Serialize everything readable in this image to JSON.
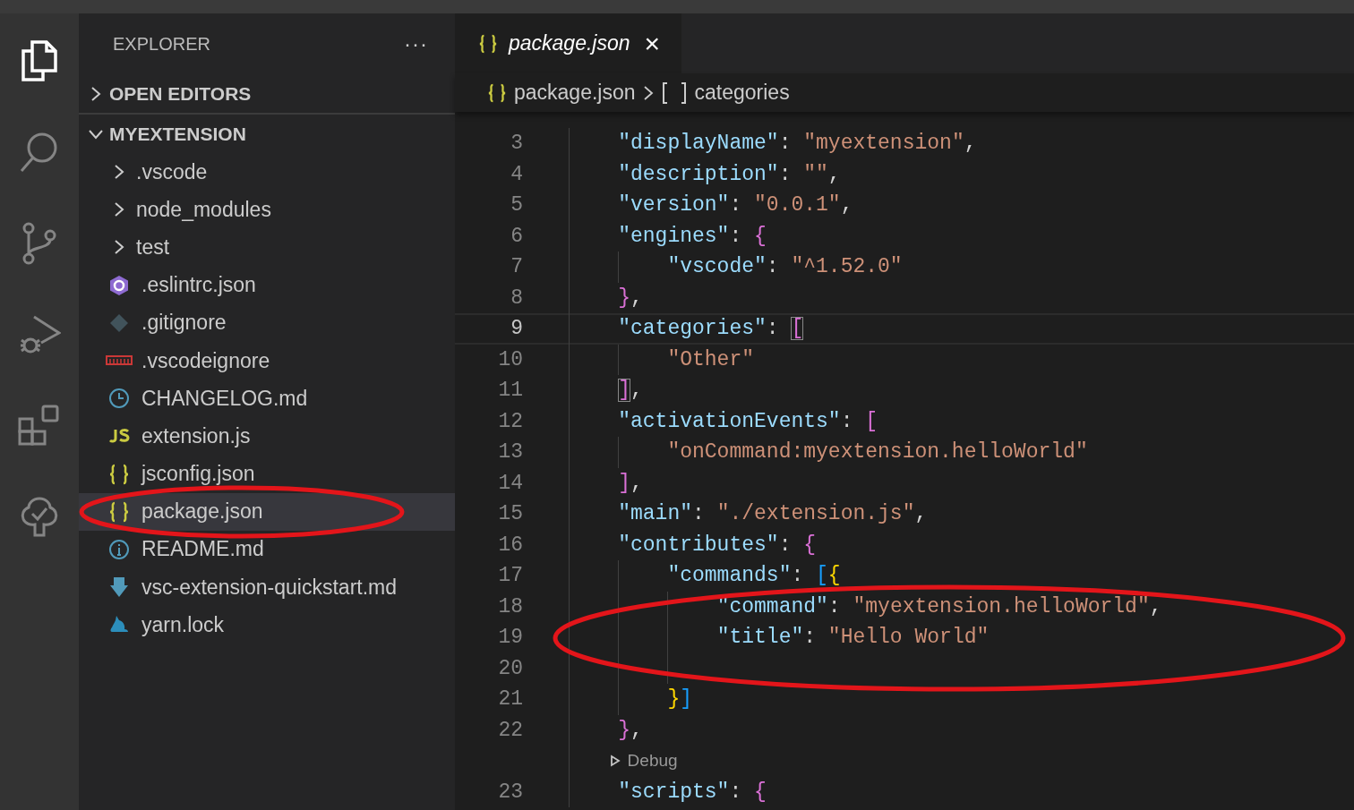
{
  "activity_bar": [
    {
      "kind": "files",
      "selected": true
    },
    {
      "kind": "search",
      "selected": false
    },
    {
      "kind": "source-control",
      "selected": false
    },
    {
      "kind": "run-debug",
      "selected": false
    },
    {
      "kind": "extensions",
      "selected": false
    },
    {
      "kind": "testing",
      "selected": false
    }
  ],
  "sidebar": {
    "title": "EXPLORER",
    "more": "···",
    "sections": [
      {
        "label": "OPEN EDITORS",
        "expanded": false
      },
      {
        "label": "MYEXTENSION",
        "expanded": true
      }
    ],
    "items": [
      {
        "kind": "folder",
        "label": ".vscode",
        "expanded": false,
        "selected": false
      },
      {
        "kind": "folder",
        "label": "node_modules",
        "expanded": false,
        "selected": false
      },
      {
        "kind": "folder",
        "label": "test",
        "expanded": false,
        "selected": false
      },
      {
        "kind": "eslint",
        "label": ".eslintrc.json",
        "selected": false
      },
      {
        "kind": "git",
        "label": ".gitignore",
        "selected": false
      },
      {
        "kind": "npm",
        "label": ".vscodeignore",
        "selected": false
      },
      {
        "kind": "changelog",
        "label": "CHANGELOG.md",
        "selected": false
      },
      {
        "kind": "js",
        "label": "extension.js",
        "selected": false
      },
      {
        "kind": "json",
        "label": "jsconfig.json",
        "selected": false
      },
      {
        "kind": "json",
        "label": "package.json",
        "selected": true
      },
      {
        "kind": "info",
        "label": "README.md",
        "selected": false
      },
      {
        "kind": "download",
        "label": "vsc-extension-quickstart.md",
        "selected": false
      },
      {
        "kind": "yarn",
        "label": "yarn.lock",
        "selected": false
      }
    ]
  },
  "tabs": [
    {
      "label": "package.json",
      "close": "×",
      "selected": true
    }
  ],
  "breadcrumb": [
    {
      "kind": "json",
      "label": "package.json"
    },
    {
      "kind": "array",
      "label": "categories"
    }
  ],
  "code": [
    {
      "number": "3",
      "current": false,
      "tokens": [
        {
          "kind": "key",
          "text": "\"displayName\""
        },
        {
          "kind": "punct",
          "text": ": "
        },
        {
          "kind": "string",
          "text": "\"myextension\""
        },
        {
          "kind": "punct",
          "text": ","
        }
      ]
    },
    {
      "number": "4",
      "current": false,
      "tokens": [
        {
          "kind": "key",
          "text": "\"description\""
        },
        {
          "kind": "punct",
          "text": ": "
        },
        {
          "kind": "string",
          "text": "\"\""
        },
        {
          "kind": "punct",
          "text": ","
        }
      ]
    },
    {
      "number": "5",
      "current": false,
      "tokens": [
        {
          "kind": "key",
          "text": "\"version\""
        },
        {
          "kind": "punct",
          "text": ": "
        },
        {
          "kind": "string",
          "text": "\"0.0.1\""
        },
        {
          "kind": "punct",
          "text": ","
        }
      ]
    },
    {
      "number": "6",
      "current": false,
      "tokens": [
        {
          "kind": "key",
          "text": "\"engines\""
        },
        {
          "kind": "punct",
          "text": ": "
        },
        {
          "kind": "bracket2",
          "text": "{"
        }
      ],
      "children": [
        {
          "number": "7",
          "current": false,
          "tokens": [
            {
              "kind": "key",
              "text": "\"vscode\""
            },
            {
              "kind": "punct",
              "text": ": "
            },
            {
              "kind": "string",
              "text": "\"^1.52.0\""
            }
          ]
        }
      ]
    },
    {
      "number": "8",
      "current": false,
      "tokens": [
        {
          "kind": "bracket2",
          "text": "}"
        },
        {
          "kind": "punct",
          "text": ","
        }
      ]
    },
    {
      "number": "9",
      "current": true,
      "tokens": [
        {
          "kind": "key",
          "text": "\"categories\""
        },
        {
          "kind": "punct",
          "text": ": "
        },
        {
          "kind": "bracket2",
          "text": "[",
          "matched": true
        }
      ],
      "children": [
        {
          "number": "10",
          "current": false,
          "tokens": [
            {
              "kind": "string",
              "text": "\"Other\""
            }
          ]
        }
      ]
    },
    {
      "number": "11",
      "current": false,
      "tokens": [
        {
          "kind": "bracket2",
          "text": "]",
          "matched": true
        },
        {
          "kind": "punct",
          "text": ","
        }
      ]
    },
    {
      "number": "12",
      "current": false,
      "tokens": [
        {
          "kind": "key",
          "text": "\"activationEvents\""
        },
        {
          "kind": "punct",
          "text": ": "
        },
        {
          "kind": "bracket2",
          "text": "["
        }
      ],
      "children": [
        {
          "number": "13",
          "current": false,
          "tokens": [
            {
              "kind": "string",
              "text": "\"onCommand:myextension.helloWorld\""
            }
          ]
        }
      ]
    },
    {
      "number": "14",
      "current": false,
      "tokens": [
        {
          "kind": "bracket2",
          "text": "]"
        },
        {
          "kind": "punct",
          "text": ","
        }
      ]
    },
    {
      "number": "15",
      "current": false,
      "tokens": [
        {
          "kind": "key",
          "text": "\"main\""
        },
        {
          "kind": "punct",
          "text": ": "
        },
        {
          "kind": "string",
          "text": "\"./extension.js\""
        },
        {
          "kind": "punct",
          "text": ","
        }
      ]
    },
    {
      "number": "16",
      "current": false,
      "tokens": [
        {
          "kind": "key",
          "text": "\"contributes\""
        },
        {
          "kind": "punct",
          "text": ": "
        },
        {
          "kind": "bracket2",
          "text": "{"
        }
      ],
      "children": [
        {
          "number": "17",
          "current": false,
          "tokens": [
            {
              "kind": "key",
              "text": "\"commands\""
            },
            {
              "kind": "punct",
              "text": ": "
            },
            {
              "kind": "bracket3",
              "text": "["
            },
            {
              "kind": "bracket1",
              "text": "{"
            }
          ],
          "children": [
            {
              "number": "18",
              "current": false,
              "tokens": [
                {
                  "kind": "key",
                  "text": "\"command\""
                },
                {
                  "kind": "punct",
                  "text": ": "
                },
                {
                  "kind": "string",
                  "text": "\"myextension.helloWorld\""
                },
                {
                  "kind": "punct",
                  "text": ","
                }
              ]
            },
            {
              "number": "19",
              "current": false,
              "tokens": [
                {
                  "kind": "key",
                  "text": "\"title\""
                },
                {
                  "kind": "punct",
                  "text": ": "
                },
                {
                  "kind": "string",
                  "text": "\"Hello World\""
                }
              ]
            },
            {
              "number": "20",
              "current": false
            }
          ]
        },
        {
          "number": "21",
          "current": false,
          "tokens": [
            {
              "kind": "bracket1",
              "text": "}"
            },
            {
              "kind": "bracket3",
              "text": "]"
            }
          ]
        }
      ]
    },
    {
      "number": "22",
      "current": false,
      "tokens": [
        {
          "kind": "bracket2",
          "text": "}"
        },
        {
          "kind": "punct",
          "text": ","
        }
      ]
    },
    {
      "kind": "codelens",
      "label": "Debug"
    },
    {
      "number": "23",
      "current": false,
      "tokens": [
        {
          "kind": "key",
          "text": "\"scripts\""
        },
        {
          "kind": "punct",
          "text": ": "
        },
        {
          "kind": "bracket2",
          "text": "{"
        }
      ]
    }
  ]
}
